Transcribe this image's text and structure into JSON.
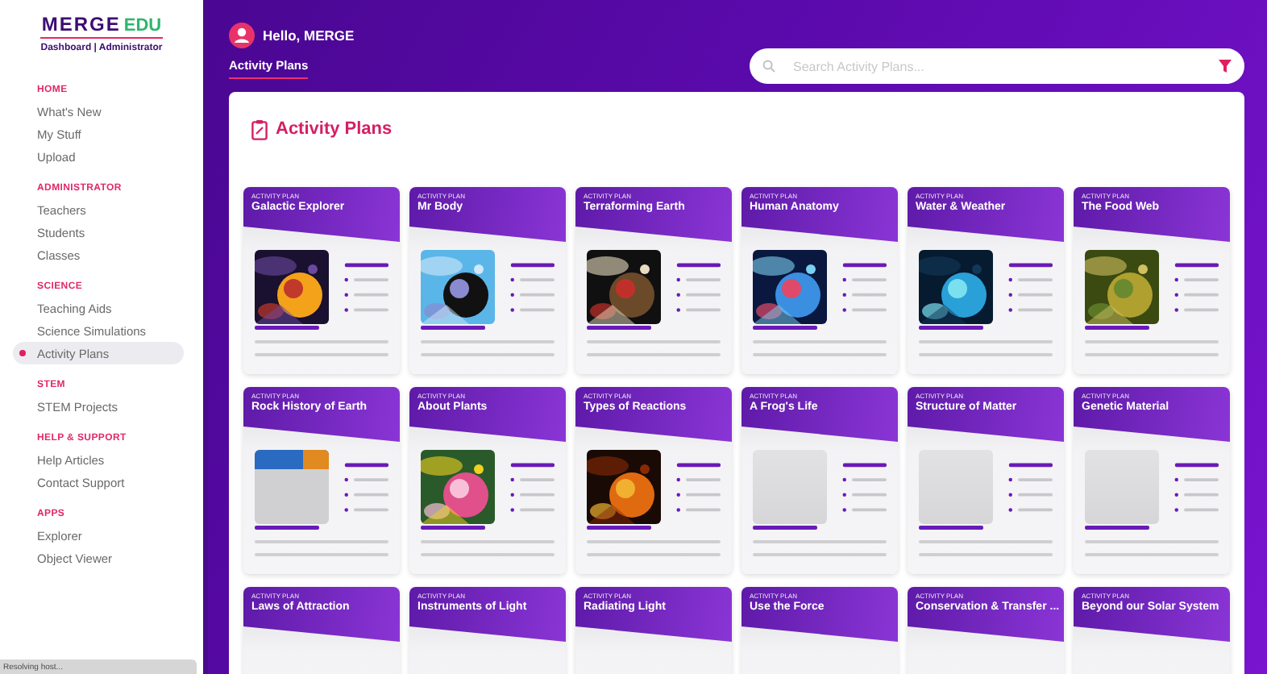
{
  "logo": {
    "brand": "MERGE",
    "suffix": "EDU",
    "subtitle": "Dashboard | Administrator"
  },
  "sidebar": {
    "sections": [
      {
        "heading": "HOME",
        "items": [
          {
            "label": "What's New",
            "selected": false
          },
          {
            "label": "My Stuff",
            "selected": false
          },
          {
            "label": "Upload",
            "selected": false
          }
        ]
      },
      {
        "heading": "ADMINISTRATOR",
        "items": [
          {
            "label": "Teachers",
            "selected": false
          },
          {
            "label": "Students",
            "selected": false
          },
          {
            "label": "Classes",
            "selected": false
          }
        ]
      },
      {
        "heading": "SCIENCE",
        "items": [
          {
            "label": "Teaching Aids",
            "selected": false
          },
          {
            "label": "Science Simulations",
            "selected": false
          },
          {
            "label": "Activity Plans",
            "selected": true
          }
        ]
      },
      {
        "heading": "STEM",
        "items": [
          {
            "label": "STEM Projects",
            "selected": false
          }
        ]
      },
      {
        "heading": "HELP & SUPPORT",
        "items": [
          {
            "label": "Help Articles",
            "selected": false
          },
          {
            "label": "Contact Support",
            "selected": false
          }
        ]
      },
      {
        "heading": "APPS",
        "items": [
          {
            "label": "Explorer",
            "selected": false
          },
          {
            "label": "Object Viewer",
            "selected": false
          }
        ]
      }
    ]
  },
  "header": {
    "greeting": "Hello, MERGE"
  },
  "tabs": [
    {
      "label": "Activity Plans",
      "selected": true
    }
  ],
  "search": {
    "placeholder": "Search Activity Plans..."
  },
  "panel": {
    "title": "Activity Plans",
    "cards": [
      {
        "tag": "ACTIVITY PLAN",
        "title": "Galactic Explorer",
        "kind": "picture"
      },
      {
        "tag": "ACTIVITY PLAN",
        "title": "Mr Body",
        "kind": "picture"
      },
      {
        "tag": "ACTIVITY PLAN",
        "title": "Terraforming Earth",
        "kind": "picture"
      },
      {
        "tag": "ACTIVITY PLAN",
        "title": "Human Anatomy",
        "kind": "picture"
      },
      {
        "tag": "ACTIVITY PLAN",
        "title": "Water & Weather",
        "kind": "picture"
      },
      {
        "tag": "ACTIVITY PLAN",
        "title": "The Food Web",
        "kind": "picture"
      },
      {
        "tag": "ACTIVITY PLAN",
        "title": "Rock History of Earth",
        "kind": "picture"
      },
      {
        "tag": "ACTIVITY PLAN",
        "title": "About Plants",
        "kind": "picture"
      },
      {
        "tag": "ACTIVITY PLAN",
        "title": "Types of Reactions",
        "kind": "picture"
      },
      {
        "tag": "ACTIVITY PLAN",
        "title": "A Frog's Life",
        "kind": "placeholder"
      },
      {
        "tag": "ACTIVITY PLAN",
        "title": "Structure of Matter",
        "kind": "placeholder"
      },
      {
        "tag": "ACTIVITY PLAN",
        "title": "Genetic Material",
        "kind": "placeholder"
      },
      {
        "tag": "ACTIVITY PLAN",
        "title": "Laws of Attraction"
      },
      {
        "tag": "ACTIVITY PLAN",
        "title": "Instruments of Light"
      },
      {
        "tag": "ACTIVITY PLAN",
        "title": "Radiating Light"
      },
      {
        "tag": "ACTIVITY PLAN",
        "title": "Use the Force"
      },
      {
        "tag": "ACTIVITY PLAN",
        "title": "Conservation & Transfer ..."
      },
      {
        "tag": "ACTIVITY PLAN",
        "title": "Beyond our Solar System"
      }
    ]
  },
  "status_bar": {
    "text": "Resolving host..."
  }
}
